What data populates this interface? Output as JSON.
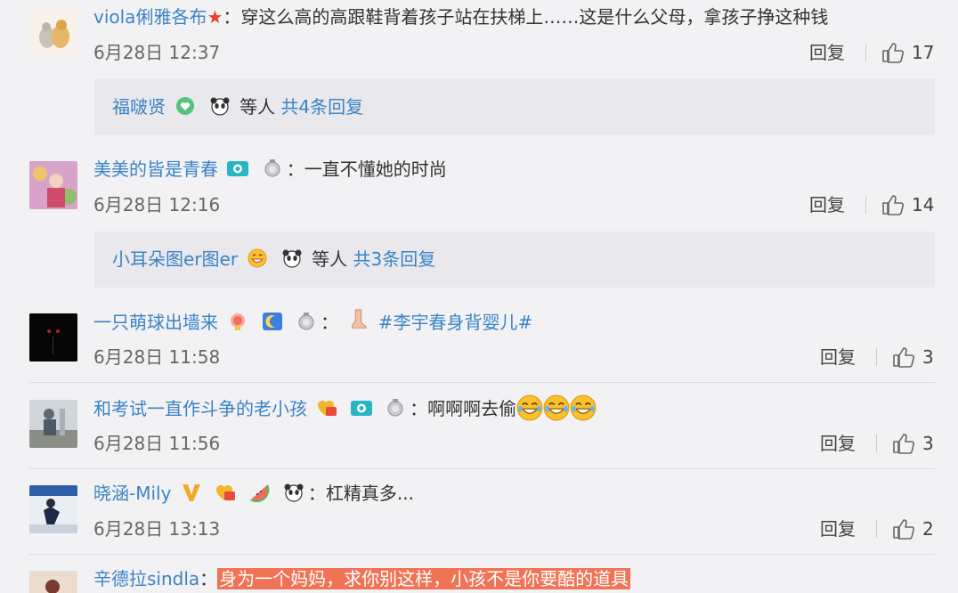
{
  "comments": [
    {
      "user": "viola俐雅各布",
      "text": "穿这么高的高跟鞋背着孩子站在扶梯上……这是什么父母，拿孩子挣这种钱",
      "time": "6月28日 12:37",
      "reply_label": "回复",
      "likes": "17",
      "subreply": {
        "names": "福啵贤",
        "others": "等人",
        "link": "共4条回复"
      }
    },
    {
      "user": "美美的皆是青春",
      "text": "一直不懂她的时尚",
      "time": "6月28日 12:16",
      "reply_label": "回复",
      "likes": "14",
      "subreply": {
        "names": "小耳朵图er图er",
        "others": "等人",
        "link": "共3条回复"
      }
    },
    {
      "user": "一只萌球出墙来",
      "topic": "#李宇春身背婴儿#",
      "time": "6月28日 11:58",
      "reply_label": "回复",
      "likes": "3"
    },
    {
      "user": "和考试一直作斗争的老小孩",
      "text": "啊啊啊去偷",
      "time": "6月28日 11:56",
      "reply_label": "回复",
      "likes": "3"
    },
    {
      "user": "晓涵-Mily",
      "text": "杠精真多...",
      "time": "6月28日 13:13",
      "reply_label": "回复",
      "likes": "2"
    },
    {
      "user": "辛德拉sindla",
      "text": "身为一个妈妈，求你别这样，小孩不是你要酷的道具"
    }
  ],
  "colon": "：",
  "colors": {
    "link": "#3b83c4",
    "highlight": "#f07356",
    "background": "#f2f2f5"
  },
  "icons": [
    "thumbs-up-icon",
    "star-icon",
    "heart-badge-icon",
    "panda-icon",
    "camera-badge-icon",
    "medal-icon",
    "grin-emoji-icon",
    "laugh-cry-emoji-icon",
    "vip-v-icon",
    "fan-badge-icon"
  ]
}
